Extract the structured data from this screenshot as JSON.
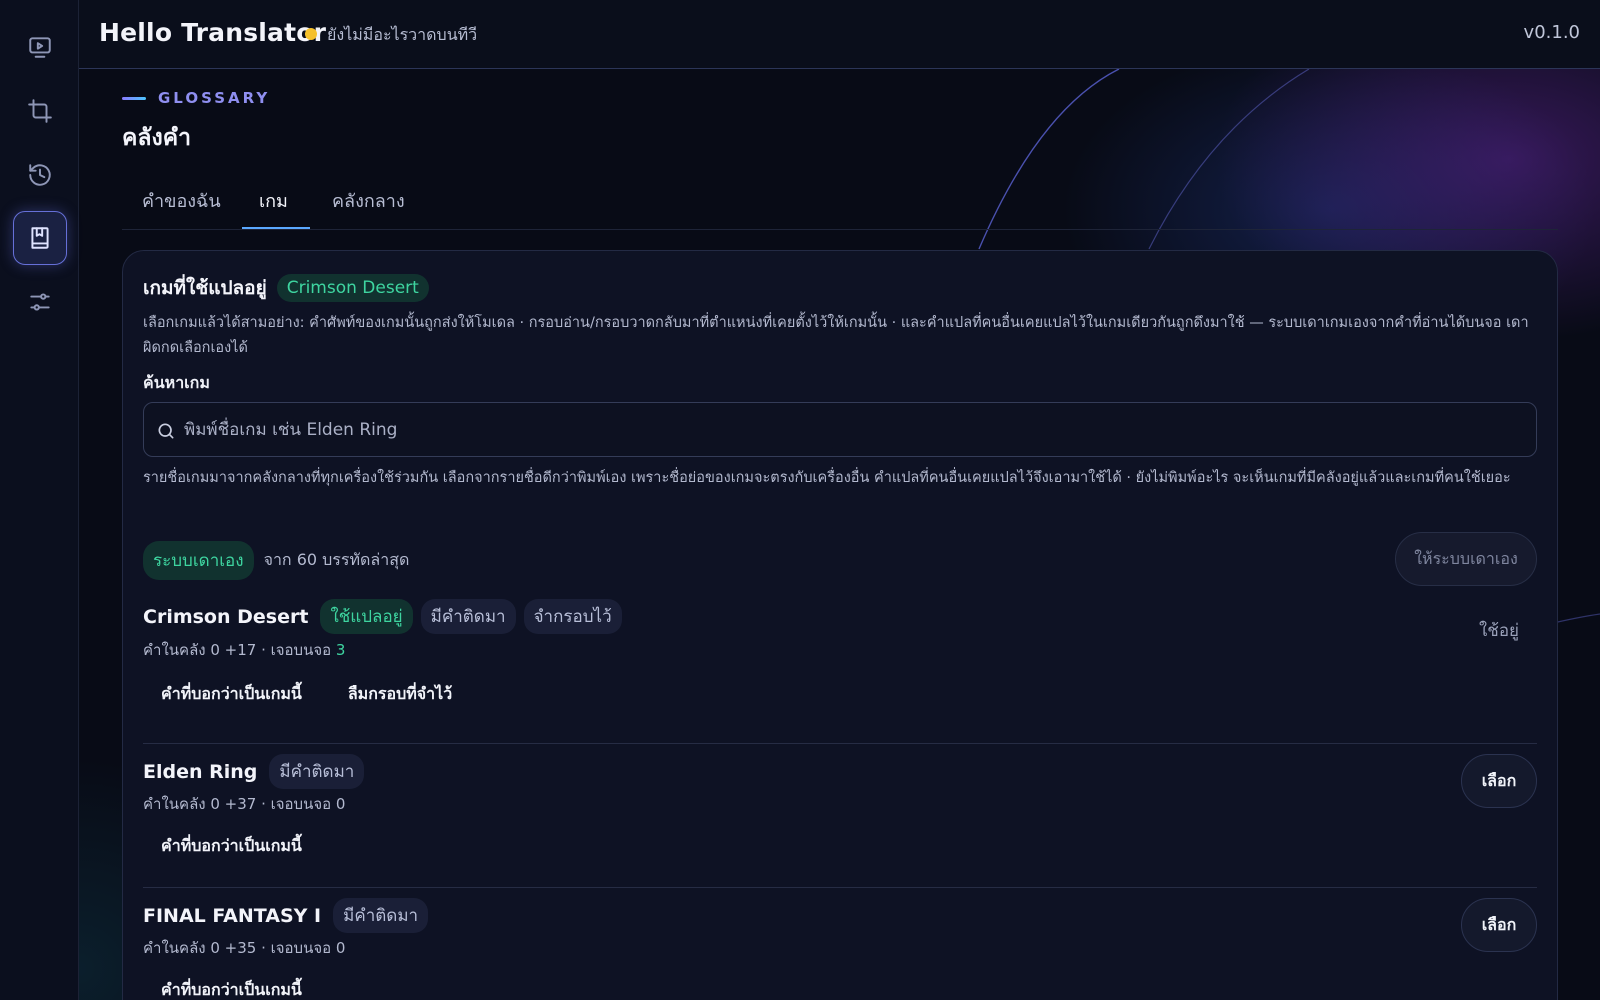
{
  "app": {
    "title": "Hello Translator",
    "status_text": "ยังไม่มีอะไรวาดบนทีวี",
    "status_color": "#f5c02b",
    "version": "v0.1.0"
  },
  "sidebar": {
    "items": [
      {
        "icon": "monitor-play-icon"
      },
      {
        "icon": "crop-icon"
      },
      {
        "icon": "history-icon"
      },
      {
        "icon": "book-icon",
        "active": true
      },
      {
        "icon": "sliders-icon"
      }
    ]
  },
  "section": {
    "eyebrow": "GLOSSARY",
    "title": "คลังคำ"
  },
  "tabs": [
    {
      "label": "คำของฉัน"
    },
    {
      "label": "เกม",
      "active": true
    },
    {
      "label": "คลังกลาง"
    }
  ],
  "card": {
    "title": "เกมที่ใช้แปลอยู่",
    "current_game": "Crimson Desert",
    "description": "เลือกเกมแล้วได้สามอย่าง: คำศัพท์ของเกมนั้นถูกส่งให้โมเดล · กรอบอ่าน/กรอบวาดกลับมาที่ตำแหน่งที่เคยตั้งไว้ให้เกมนั้น · และคำแปลที่คนอื่นเคยแปลไว้ในเกมเดียวกันถูกดึงมาใช้ — ระบบเดาเกมเองจากคำที่อ่านได้บนจอ เดาผิดกดเลือกเองได้",
    "search_label": "ค้นหาเกม",
    "search_placeholder": "พิมพ์ชื่อเกม เช่น Elden Ring",
    "search_value": "",
    "hint": "รายชื่อเกมมาจากคลังกลางที่ทุกเครื่องใช้ร่วมกัน เลือกจากรายชื่อดีกว่าพิมพ์เอง เพราะชื่อย่อของเกมจะตรงกับเครื่องอื่น คำแปลที่คนอื่นเคยแปลไว้จึงเอามาใช้ได้ · ยังไม่พิมพ์อะไร จะเห็นเกมที่มีคลังอยู่แล้วและเกมที่คนใช้เยอะ",
    "auto_chip": "ระบบเดาเอง",
    "auto_sub": "จาก 60 บรรทัดล่าสุด",
    "auto_button": "ให้ระบบเดาเอง"
  },
  "games": [
    {
      "name": "Crimson Desert",
      "chips": [
        "ใช้แปลอยู่",
        "มีคำติดมา",
        "จำกรอบไว้"
      ],
      "meta_prefix": "คำในคลัง 0 +17 · เจอบนจอ ",
      "meta_count": "3",
      "actions": [
        "คำที่บอกว่าเป็นเกมนี้",
        "ลืมกรอบที่จำไว้"
      ],
      "status": "ใช้อยู่"
    },
    {
      "name": "Elden Ring",
      "chips": [
        "มีคำติดมา"
      ],
      "meta_prefix": "คำในคลัง 0 +37 · เจอบนจอ ",
      "meta_count": "0",
      "actions": [
        "คำที่บอกว่าเป็นเกมนี้"
      ],
      "button": "เลือก"
    },
    {
      "name": "FINAL FANTASY I",
      "chips": [
        "มีคำติดมา"
      ],
      "meta_prefix": "คำในคลัง 0 +35 · เจอบนจอ ",
      "meta_count": "0",
      "actions": [
        "คำที่บอกว่าเป็นเกมนี้"
      ],
      "button": "เลือก"
    }
  ]
}
